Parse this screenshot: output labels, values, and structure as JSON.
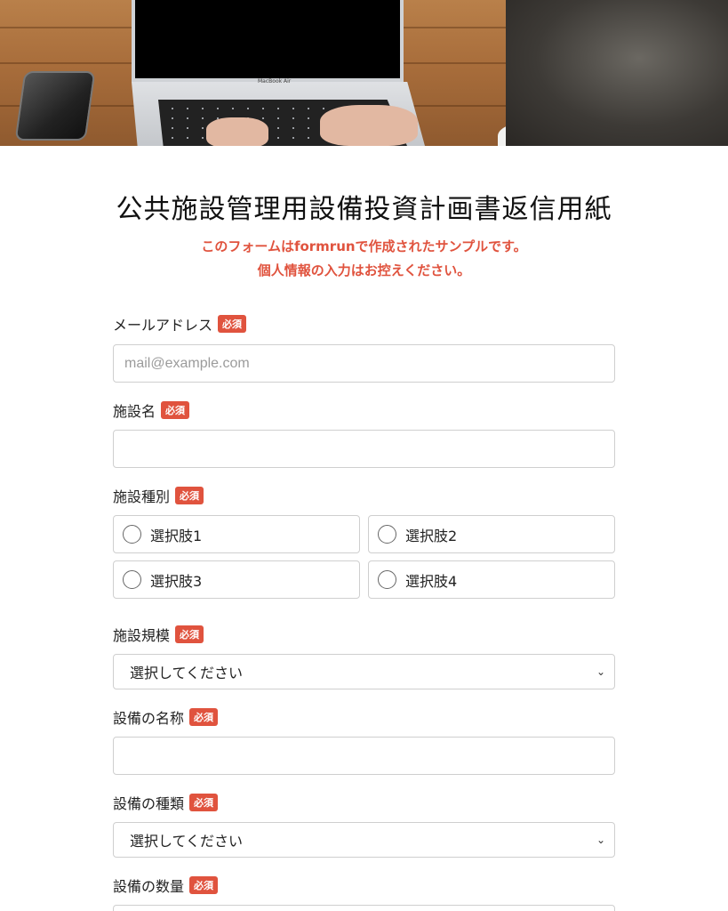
{
  "hero": {
    "laptop_brand": "MacBook Air"
  },
  "form": {
    "title": "公共施設管理用設備投資計画書返信用紙",
    "notice_line1": "このフォームはformrunで作成されたサンプルです。",
    "notice_line2": "個人情報の入力はお控えください。",
    "required_badge": "必須",
    "fields": {
      "email": {
        "label": "メールアドレス",
        "placeholder": "mail@example.com",
        "value": ""
      },
      "facility_name": {
        "label": "施設名",
        "value": ""
      },
      "facility_type": {
        "label": "施設種別",
        "options": [
          "選択肢1",
          "選択肢2",
          "選択肢3",
          "選択肢4"
        ]
      },
      "facility_scale": {
        "label": "施設規模",
        "selected": "選択してください"
      },
      "equipment_name": {
        "label": "設備の名称",
        "value": ""
      },
      "equipment_type": {
        "label": "設備の種類",
        "selected": "選択してください"
      },
      "equipment_quantity": {
        "label": "設備の数量"
      }
    }
  },
  "colors": {
    "accent": "#e0533e",
    "border": "#cfcfcf"
  }
}
